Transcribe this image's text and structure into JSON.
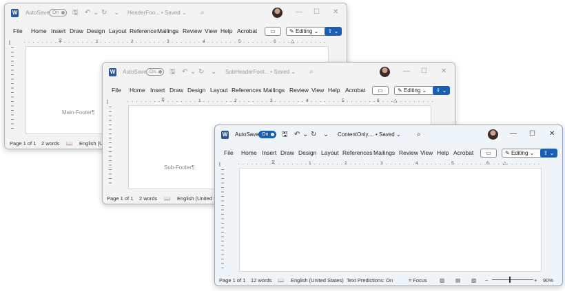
{
  "app": {
    "logo": "W",
    "autosave_label": "AutoSave",
    "ribbon_menu": [
      "File",
      "Home",
      "Insert",
      "Draw",
      "Design",
      "Layout",
      "Reference",
      "Mailings",
      "Review",
      "View",
      "Help",
      "Acrobat"
    ],
    "ribbon_menu_full": [
      "File",
      "Home",
      "Insert",
      "Draw",
      "Design",
      "Layout",
      "References",
      "Mailings",
      "Review",
      "View",
      "Help",
      "Acrobat"
    ],
    "editing_label": "Editing",
    "ruler_numbers": [
      "1",
      "2",
      "3",
      "4",
      "5",
      "6"
    ],
    "icons": {
      "save": "save-icon",
      "undo": "undo-icon",
      "redo": "redo-icon",
      "customize": "customize-icon",
      "search": "search-icon",
      "comment": "comment-icon",
      "pencil": "pencil-icon",
      "share": "share-icon",
      "minimize": "minimize-icon",
      "maximize": "maximize-icon",
      "close": "close-icon",
      "proofing": "book-icon",
      "focus": "focus-icon",
      "read_mode": "read-mode-icon",
      "print_layout": "print-layout-icon",
      "web_layout": "web-layout-icon"
    },
    "colors": {
      "accent": "#1a5fb4",
      "word_blue": "#2b579a"
    }
  },
  "windows": [
    {
      "id": "main",
      "doc_title": "HeaderFoo...",
      "save_state": "Saved",
      "autosave_state": "On",
      "body_text": "Main-Footer¶",
      "status": {
        "page": "Page 1 of 1",
        "words": "2 words",
        "language": "English (Uni"
      }
    },
    {
      "id": "sub",
      "doc_title": "SubHeaderFoot...",
      "save_state": "Saved",
      "autosave_state": "On",
      "body_text": "Sub-Footer¶",
      "status": {
        "page": "Page 1 of 1",
        "words": "2 words",
        "language": "English (United St"
      }
    },
    {
      "id": "content",
      "doc_title": "ContentOnly....",
      "save_state": "Saved",
      "autosave_state": "On",
      "body_text": "",
      "status": {
        "page": "Page 1 of 1",
        "words": "12 words",
        "language": "English (United States)",
        "predictions": "Text Predictions: On",
        "focus": "Focus",
        "zoom_minus": "−",
        "zoom_plus": "+",
        "zoom": "90%"
      },
      "zoom_level_percent": 90
    }
  ]
}
